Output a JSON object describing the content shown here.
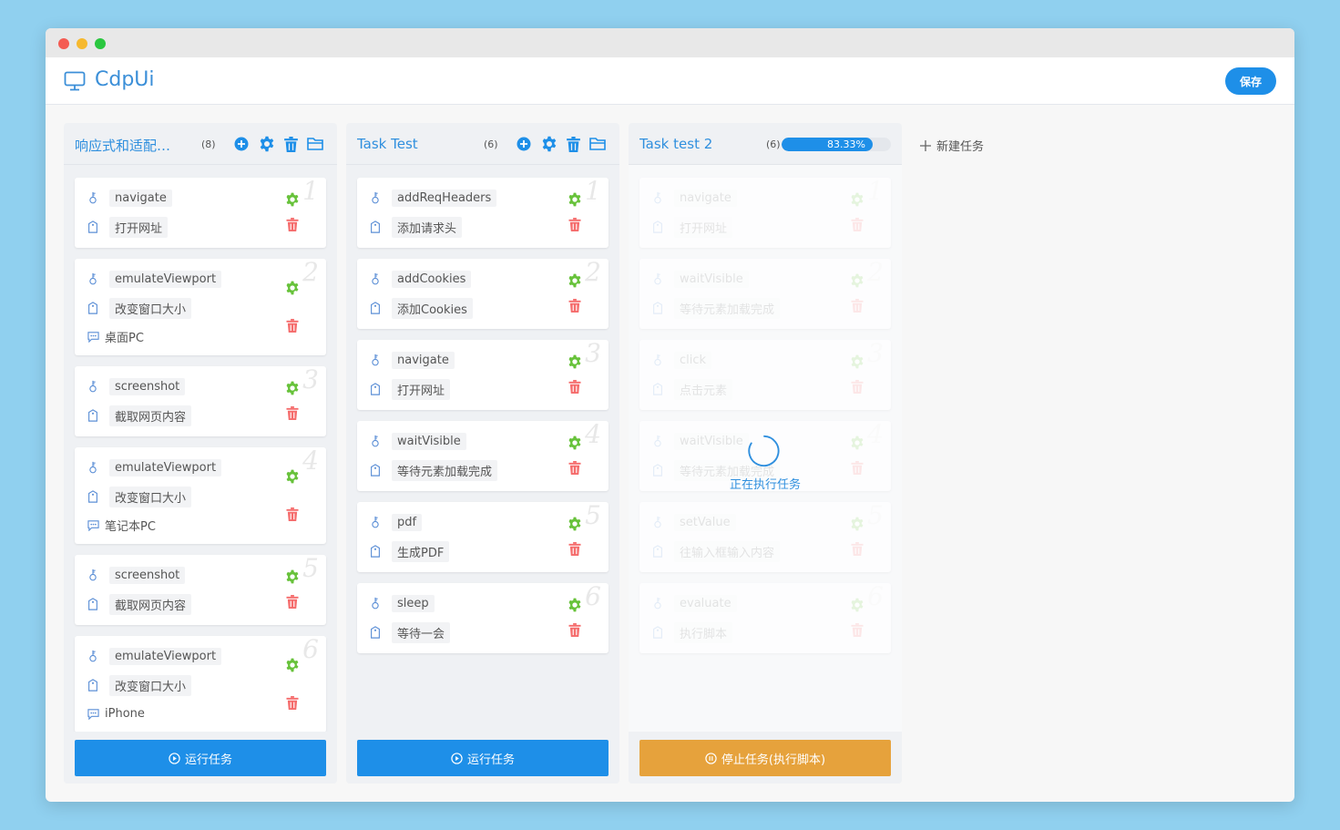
{
  "app": {
    "title": "CdpUi",
    "save_label": "保存"
  },
  "new_task_label": "新建任务",
  "colors": {
    "accent": "#1e8fe8",
    "stop": "#e6a23c",
    "gear": "#67c23a",
    "trash": "#f56c6c"
  },
  "icons": [
    "monitor-icon",
    "plus-circle-icon",
    "gear-icon",
    "trash-icon",
    "folder-icon",
    "key-icon",
    "tag-icon",
    "comment-icon",
    "play-icon",
    "pause-icon",
    "plus-icon"
  ],
  "columns": [
    {
      "title": "响应式和适配…",
      "count": "(8)",
      "button_label": "运行任务",
      "cards": [
        {
          "num": "1",
          "action": "navigate",
          "desc": "打开网址"
        },
        {
          "num": "2",
          "action": "emulateViewport",
          "desc": "改变窗口大小",
          "note": "桌面PC"
        },
        {
          "num": "3",
          "action": "screenshot",
          "desc": "截取网页内容"
        },
        {
          "num": "4",
          "action": "emulateViewport",
          "desc": "改变窗口大小",
          "note": "笔记本PC"
        },
        {
          "num": "5",
          "action": "screenshot",
          "desc": "截取网页内容"
        },
        {
          "num": "6",
          "action": "emulateViewport",
          "desc": "改变窗口大小",
          "note": "iPhone"
        }
      ]
    },
    {
      "title": "Task Test",
      "count": "(6)",
      "button_label": "运行任务",
      "cards": [
        {
          "num": "1",
          "action": "addReqHeaders",
          "desc": "添加请求头"
        },
        {
          "num": "2",
          "action": "addCookies",
          "desc": "添加Cookies"
        },
        {
          "num": "3",
          "action": "navigate",
          "desc": "打开网址"
        },
        {
          "num": "4",
          "action": "waitVisible",
          "desc": "等待元素加载完成"
        },
        {
          "num": "5",
          "action": "pdf",
          "desc": "生成PDF"
        },
        {
          "num": "6",
          "action": "sleep",
          "desc": "等待一会"
        }
      ]
    },
    {
      "title": "Task test 2",
      "count": "(6)",
      "progress": 83.33,
      "progress_label": "83.33%",
      "running_label": "正在执行任务",
      "button_label": "停止任务(执行脚本)",
      "cards": [
        {
          "num": "1",
          "action": "navigate",
          "desc": "打开网址"
        },
        {
          "num": "2",
          "action": "waitVisible",
          "desc": "等待元素加载完成"
        },
        {
          "num": "3",
          "action": "click",
          "desc": "点击元素"
        },
        {
          "num": "4",
          "action": "waitVisible",
          "desc": "等待元素加载完成"
        },
        {
          "num": "5",
          "action": "setValue",
          "desc": "往输入框输入内容"
        },
        {
          "num": "6",
          "action": "evaluate",
          "desc": "执行脚本"
        }
      ]
    }
  ]
}
